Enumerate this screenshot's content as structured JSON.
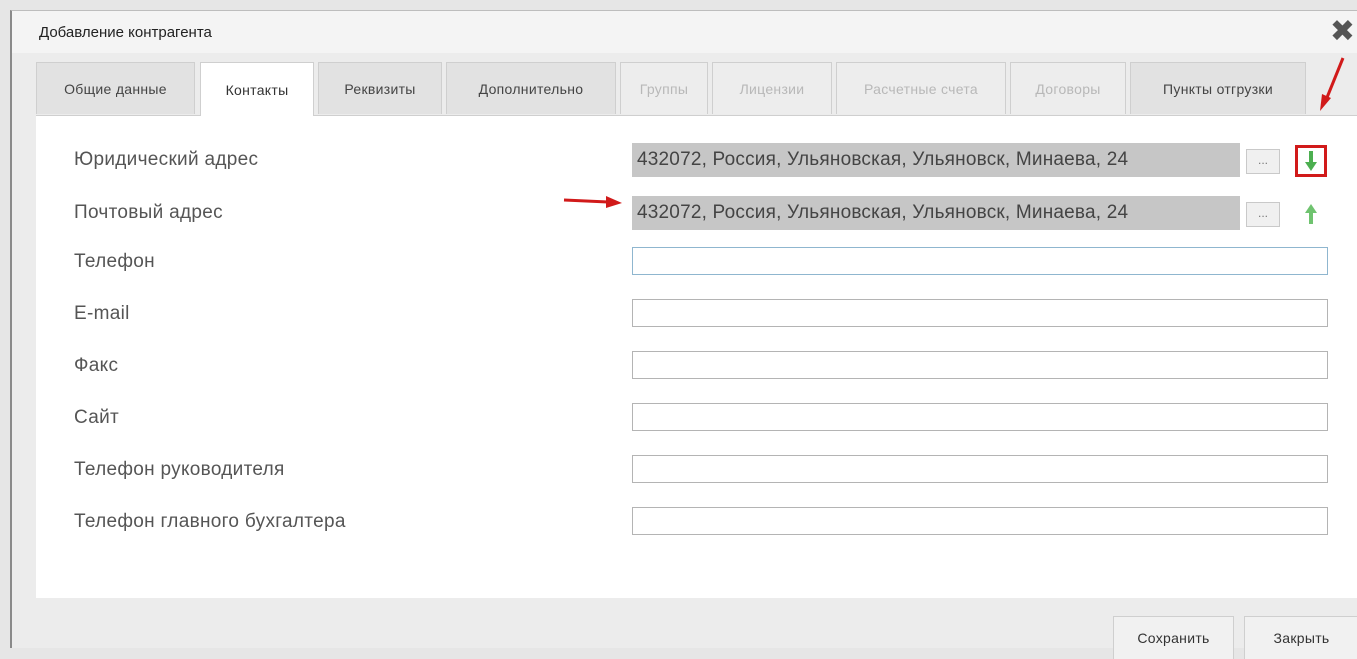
{
  "dialog": {
    "title": "Добавление контрагента"
  },
  "tabs": [
    {
      "label": "Общие данные",
      "state": "normal"
    },
    {
      "label": "Контакты",
      "state": "active"
    },
    {
      "label": "Реквизиты",
      "state": "normal"
    },
    {
      "label": "Дополнительно",
      "state": "normal"
    },
    {
      "label": "Группы",
      "state": "disabled"
    },
    {
      "label": "Лицензии",
      "state": "disabled"
    },
    {
      "label": "Расчетные счета",
      "state": "disabled"
    },
    {
      "label": "Договоры",
      "state": "disabled"
    },
    {
      "label": "Пункты отгрузки",
      "state": "normal"
    }
  ],
  "fields": {
    "legal_address": {
      "label": "Юридический адрес",
      "value": "432072, Россия, Ульяновская, Ульяновск, Минаева, 24"
    },
    "postal_address": {
      "label": "Почтовый адрес",
      "value": "432072, Россия, Ульяновская, Ульяновск, Минаева, 24"
    },
    "phone": {
      "label": "Телефон",
      "value": ""
    },
    "email": {
      "label": "E-mail",
      "value": ""
    },
    "fax": {
      "label": "Факс",
      "value": ""
    },
    "site": {
      "label": "Сайт",
      "value": ""
    },
    "director_phone": {
      "label": "Телефон руководителя",
      "value": ""
    },
    "accountant_phone": {
      "label": "Телефон главного бухгалтера",
      "value": ""
    }
  },
  "buttons": {
    "dots_label": "...",
    "save": "Сохранить",
    "close": "Закрыть"
  },
  "colors": {
    "arrow_green": "#4caf50",
    "annotation_red": "#d11a1a"
  }
}
